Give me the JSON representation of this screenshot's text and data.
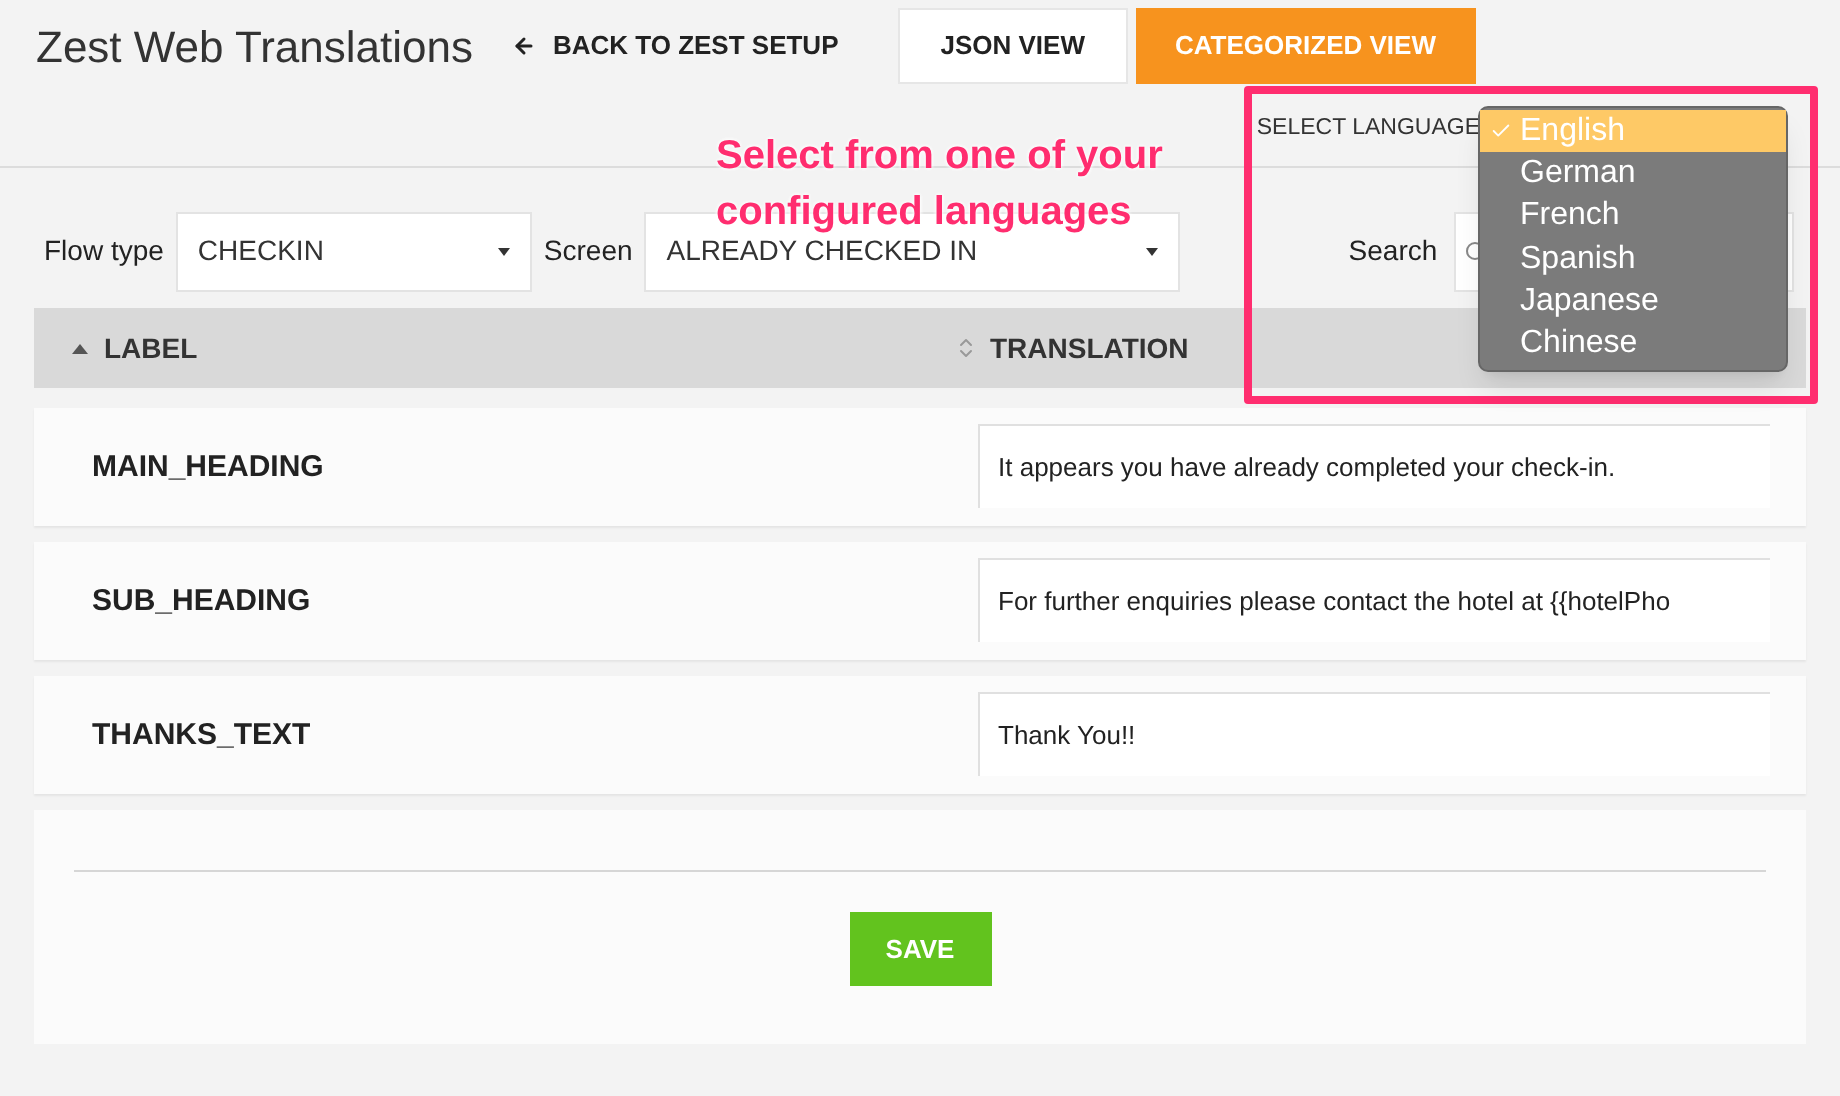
{
  "header": {
    "title": "Zest Web Translations",
    "back_link": "BACK TO ZEST SETUP",
    "view_tabs": [
      {
        "label": "JSON VIEW",
        "selected": false
      },
      {
        "label": "CATEGORIZED VIEW",
        "selected": true
      }
    ]
  },
  "language": {
    "label": "SELECT LANGUAGE",
    "options": [
      {
        "label": "English",
        "selected": true
      },
      {
        "label": "German",
        "selected": false
      },
      {
        "label": "French",
        "selected": false
      },
      {
        "label": "Spanish",
        "selected": false
      },
      {
        "label": "Japanese",
        "selected": false
      },
      {
        "label": "Chinese",
        "selected": false
      }
    ]
  },
  "annotation": "Select from one of your configured languages",
  "filters": {
    "flow_type": {
      "label": "Flow type",
      "value": "CHECKIN"
    },
    "screen": {
      "label": "Screen",
      "value": "ALREADY CHECKED IN"
    },
    "search": {
      "label": "Search"
    }
  },
  "table": {
    "columns": [
      {
        "label": "LABEL",
        "sorted": true
      },
      {
        "label": "TRANSLATION",
        "sorted": false
      }
    ],
    "rows": [
      {
        "label": "MAIN_HEADING",
        "translation": "It appears you have already completed your check-in."
      },
      {
        "label": "SUB_HEADING",
        "translation": "For further enquiries please contact the hotel at {{hotelPho"
      },
      {
        "label": "THANKS_TEXT",
        "translation": "Thank You!!"
      }
    ]
  },
  "save_button": "SAVE"
}
